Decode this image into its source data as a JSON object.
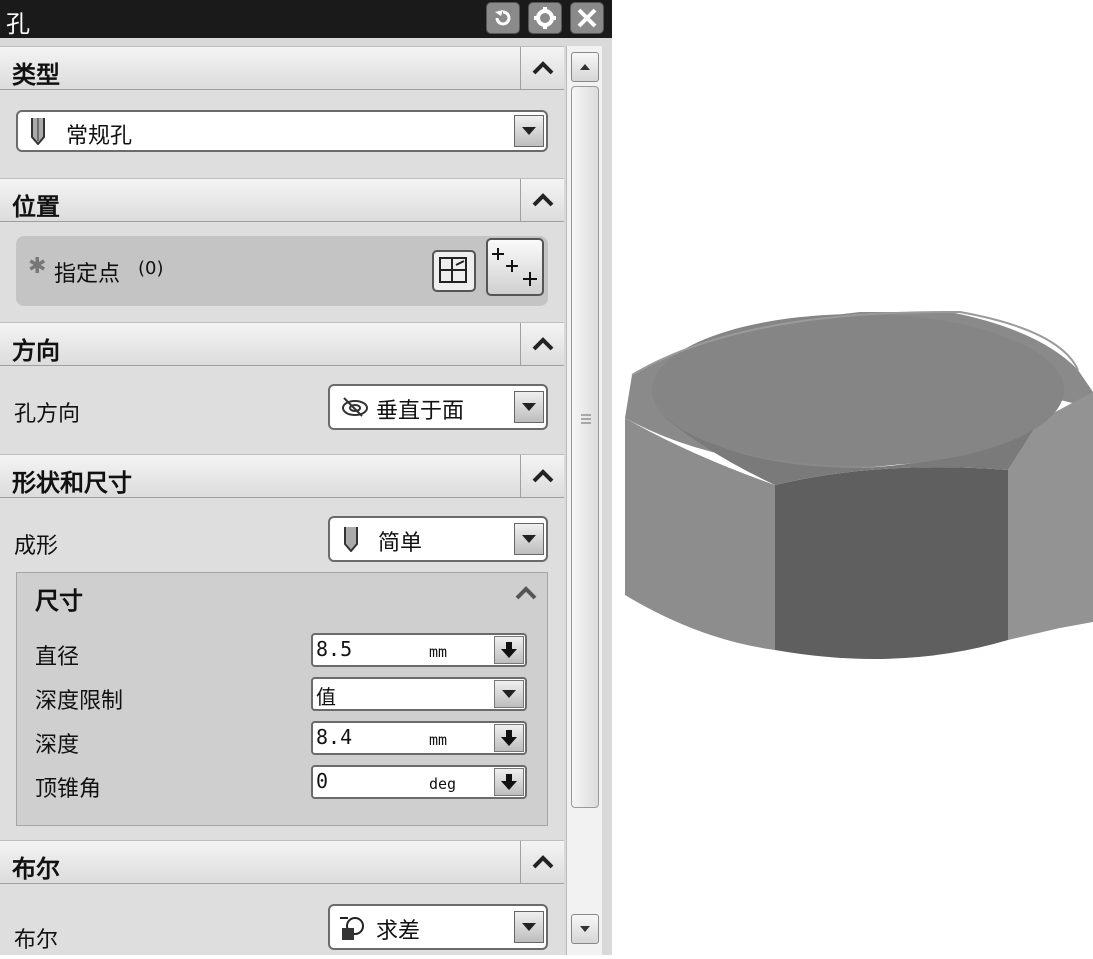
{
  "window": {
    "title": "孔"
  },
  "sections": {
    "type": {
      "title": "类型",
      "dropdown_value": "常规孔"
    },
    "position": {
      "title": "位置",
      "specify_point_label": "指定点",
      "point_count": "(0)"
    },
    "direction": {
      "title": "方向",
      "hole_direction_label": "孔方向",
      "hole_direction_value": "垂直于面"
    },
    "shape": {
      "title": "形状和尺寸",
      "form_label": "成形",
      "form_value": "简单",
      "dimensions": {
        "title": "尺寸",
        "diameter": {
          "label": "直径",
          "value": "8.5",
          "unit": "mm"
        },
        "depth_limit": {
          "label": "深度限制",
          "value": "值"
        },
        "depth": {
          "label": "深度",
          "value": "8.4",
          "unit": "mm"
        },
        "tip_angle": {
          "label": "顶锥角",
          "value": "0",
          "unit": "deg"
        }
      }
    },
    "boolean": {
      "title": "布尔",
      "label": "布尔",
      "value": "求差"
    }
  },
  "icons": {
    "reset": "reset-icon",
    "settings": "gear-icon",
    "close": "close-icon",
    "collapse": "chevron-up-icon",
    "dropdown": "chevron-down-icon",
    "hole": "hole-tool-icon",
    "sketch": "sketch-icon",
    "point": "point-constructor-icon",
    "normal": "normal-to-face-icon",
    "subtract": "boolean-subtract-icon"
  },
  "colors": {
    "titlebar": "#1a1a1a",
    "panel": "#dedede",
    "model": "#808080"
  }
}
